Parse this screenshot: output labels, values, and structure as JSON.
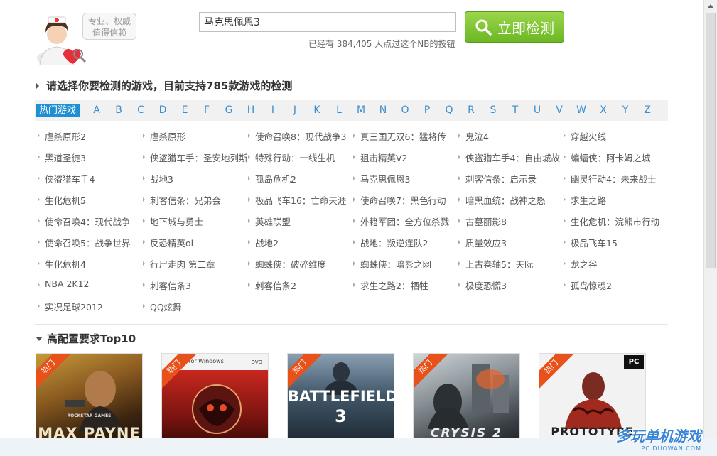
{
  "header": {
    "bubble_line1": "专业、权威",
    "bubble_line2": "值得信赖",
    "search_value": "马克思佩恩3",
    "detect_button": "立即检测",
    "count_text": "已经有 384,405 人点过这个NB的按钮"
  },
  "section1_title": "请选择你要检测的游戏，目前支持785款游戏的检测",
  "hot_tab": "热门游戏",
  "letters": [
    "A",
    "B",
    "C",
    "D",
    "E",
    "F",
    "G",
    "H",
    "I",
    "J",
    "K",
    "L",
    "M",
    "N",
    "O",
    "P",
    "Q",
    "R",
    "S",
    "T",
    "U",
    "V",
    "W",
    "X",
    "Y",
    "Z"
  ],
  "games": [
    [
      "虐杀原形2",
      "虐杀原形",
      "使命召唤8：现代战争3",
      "真三国无双6：猛将传",
      "鬼泣4",
      "穿越火线"
    ],
    [
      "黑道圣徒3",
      "侠盗猎车手：圣安地列斯",
      "特殊行动：一线生机",
      "狙击精英V2",
      "侠盗猎车手4：自由城故",
      "蝙蝠侠：阿卡姆之城"
    ],
    [
      "侠盗猎车手4",
      "战地3",
      "孤岛危机2",
      "马克思佩恩3",
      "刺客信条：启示录",
      "幽灵行动4：未来战士"
    ],
    [
      "生化危机5",
      "刺客信条：兄弟会",
      "极品飞车16：亡命天涯",
      "使命召唤7：黑色行动",
      "暗黑血统：战神之怒",
      "求生之路"
    ],
    [
      "使命召唤4：现代战争",
      "地下城与勇士",
      "英雄联盟",
      "外籍军团：全方位杀戮",
      "古墓丽影8",
      "生化危机：浣熊市行动"
    ],
    [
      "使命召唤5：战争世界",
      "反恐精英ol",
      "战地2",
      "战地：叛逆连队2",
      "质量效应3",
      "极品飞车15"
    ],
    [
      "生化危机4",
      "行尸走肉 第二章",
      "蜘蛛侠：破碎维度",
      "蜘蛛侠：暗影之网",
      "上古卷轴5：天际",
      "龙之谷"
    ],
    [
      "NBA 2K12",
      "刺客信条3",
      "刺客信条2",
      "求生之路2：牺牲",
      "极度恐慌3",
      "孤岛惊魂2"
    ],
    [
      "实况足球2012",
      "QQ炫舞"
    ]
  ],
  "section2_title": "高配置要求Top10",
  "cards": [
    {
      "ribbon": "热门",
      "cover": "MAX PAYNE 3",
      "top": "ROCKSTAR GAMES"
    },
    {
      "ribbon": "热门",
      "cover": "",
      "top": "es for Windows",
      "side": "DVD"
    },
    {
      "ribbon": "热门",
      "cover": "BATTLEFIELD",
      "num": "3"
    },
    {
      "ribbon": "热门",
      "cover": "CRYSIS 2"
    },
    {
      "ribbon": "热门",
      "cover": "PROTOTYPE",
      "top": "PC"
    }
  ],
  "watermark": {
    "main": "多玩单机游戏",
    "sub": "PC.DUOWAN.COM"
  },
  "colors": {
    "accent": "#1f8fd1",
    "button_green": "#6cb724",
    "ribbon": "#e8511a"
  }
}
